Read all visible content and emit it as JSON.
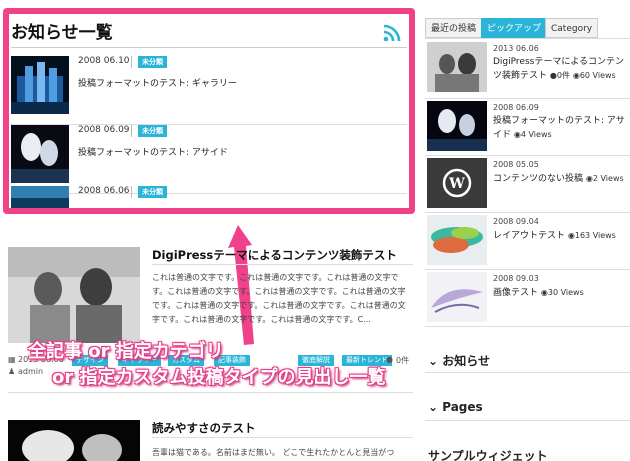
{
  "news": {
    "title": "お知らせ一覧",
    "items": [
      {
        "date": "2008 06.10",
        "badge": "未分類",
        "title": "投稿フォーマットのテスト: ギャラリー"
      },
      {
        "date": "2008 06.09",
        "badge": "未分類",
        "title": "投稿フォーマットのテスト: アサイド"
      },
      {
        "date": "2008 06.06",
        "badge": "未分類",
        "title": ""
      }
    ]
  },
  "posts": [
    {
      "title": "DigiPressテーマによるコンテンツ装飾テスト",
      "body": "これは普通の文字です。これは普通の文字です。これは普通の文字です。これは普通の文字です。これは普通の文字です。これは普通の文字です。これは普通の文字です。これは普通の文字です。これは普通の文字です。これは普通の文字です。これは普通の文字です。C..."
    },
    {
      "title": "読みやすさのテスト",
      "body": "吾輩は猫である。名前はまだ無い。 どこで生れたかとんと見当がつ"
    }
  ],
  "meta": {
    "date": "2013 06.06",
    "tags": [
      "デザイン",
      "ギャラリー",
      "カスタム",
      "記事装飾",
      "徹底解説",
      "最新トレンド"
    ],
    "comments": "0件",
    "author": "admin"
  },
  "overlay": {
    "line1": "全記事 or 指定カテゴリ",
    "line2": "or 指定カスタム投稿タイプの見出し一覧"
  },
  "sidebar": {
    "tabs": [
      "最近の投稿",
      "ピックアップ",
      "Category"
    ],
    "items": [
      {
        "date": "2013 06.06",
        "title": "DigiPressテーマによるコンテンツ装飾テスト",
        "comments": "0件",
        "views": "60 Views"
      },
      {
        "date": "2008 06.09",
        "title": "投稿フォーマットのテスト: アサイド",
        "comments": "",
        "views": "4 Views"
      },
      {
        "date": "2008 05.05",
        "title": "コンテンツのない投稿",
        "comments": "",
        "views": "2 Views"
      },
      {
        "date": "2008 09.04",
        "title": "レイアウトテスト",
        "comments": "",
        "views": "163 Views"
      },
      {
        "date": "2008 09.03",
        "title": "画像テスト",
        "comments": "",
        "views": "30 Views"
      }
    ],
    "headings": [
      "お知らせ",
      "Pages",
      "サンプルウィジェット"
    ]
  },
  "colors": {
    "accent": "#2ab5d8",
    "highlight": "#f0418b"
  }
}
